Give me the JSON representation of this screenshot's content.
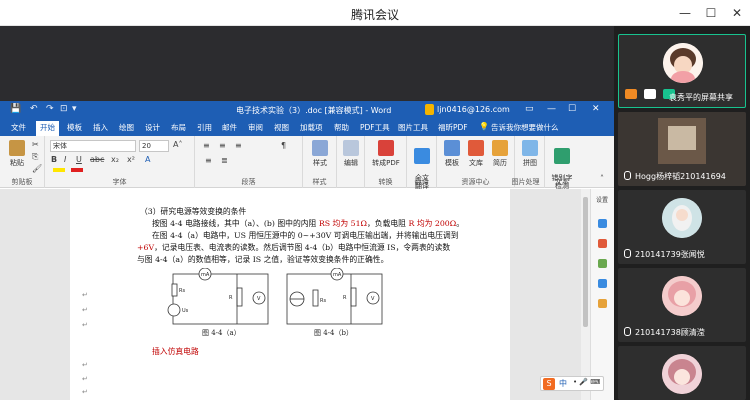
{
  "meeting": {
    "title": "腾讯会议",
    "minimize": "—",
    "maximize": "☐",
    "close": "✕"
  },
  "word": {
    "quick_access": [
      "💾",
      "↶",
      "↷",
      "⊡",
      "▾"
    ],
    "title": "电子技术实验（3）.doc [兼容模式] - Word",
    "account": "ljn0416@126.com",
    "window_controls": [
      "▭",
      "—",
      "☐",
      "✕"
    ],
    "tabs": [
      "文件",
      "开始",
      "模板",
      "插入",
      "绘图",
      "设计",
      "布局",
      "引用",
      "邮件",
      "审阅",
      "视图",
      "加载项",
      "帮助",
      "PDF工具",
      "图片工具",
      "福昕PDF",
      "告诉我你想要做什么"
    ],
    "active_tab": "开始",
    "ribbon": {
      "paste": "粘贴",
      "clipboard": "剪贴板",
      "font_name": "宋体",
      "font_size": "20",
      "font": "字体",
      "paragraph": "段落",
      "styles": "样式",
      "styles_group": "样式",
      "editing": "编辑",
      "to_pdf": "转成PDF",
      "convert": "转换",
      "translate": "全文\n翻译",
      "translate_group": "翻译",
      "template": "模板",
      "library": "文库",
      "resume": "简历",
      "resource_center": "资源中心",
      "collage": "拼图",
      "image_processing": "图片处理",
      "typo_check": "错别字\n检测",
      "text_group": "文本",
      "font_buttons": [
        "B",
        "I",
        "U",
        "abc",
        "x₂",
        "x²",
        "A"
      ],
      "para_buttons": [
        "≡",
        "≡",
        "≡",
        "≡",
        "≣",
        "¶"
      ]
    },
    "doc": {
      "line1": "（3）研究电源等效变换的条件",
      "line2_a": "按图 4-4 电路接线，其中（a）、(b) 图中的内阻 ",
      "line2_b": "RS 均为 51Ω",
      "line2_c": "，负载电阻 ",
      "line2_d": "R 均为 200Ω",
      "line2_e": "。",
      "line3": "在图 4-4（a）电路中，US 用恒压源中的 0~+30V 可调电压输出端，并将输出电压调到",
      "line4_a": "+6V",
      "line4_b": "，记录电压表、电流表的读数。然后调节图 4-4（b）电路中恒流源 IS，令两表的读数",
      "line5": "与图 4-4（a）的数值相等，记录 IS 之值，验证等效变换条件的正确性。",
      "caption_a": "图 4-4（a）",
      "caption_b": "图 4-4（b）",
      "sim": "插入仿真电路",
      "labels": {
        "mA": "mA",
        "V": "V",
        "R": "R",
        "Rs": "Rs",
        "Us": "Us"
      }
    },
    "ime": {
      "logo": "S",
      "lang": "中",
      "others": "• 🎤 ⌨"
    }
  },
  "sidebar": {
    "tiles": [
      {
        "name": "袁秀平的屏幕共享",
        "active": true
      },
      {
        "name": "Hogg杨梓韬210141694",
        "active": false
      },
      {
        "name": "210141739张闻悦",
        "active": false
      },
      {
        "name": "210141738顾清滢",
        "active": false
      },
      {
        "name": "",
        "active": false
      }
    ]
  },
  "colors": {
    "word_blue": "#1e5eb4",
    "accent": "#18c38f",
    "red_text": "#c00000",
    "dark_bg": "#2c2c2f",
    "sidebar_bg": "#1f1f1f"
  }
}
